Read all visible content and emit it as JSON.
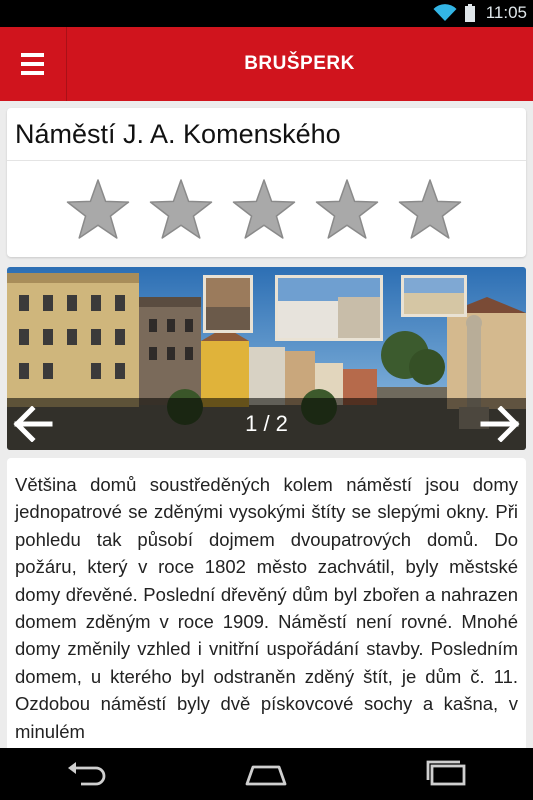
{
  "status_bar": {
    "time": "11:05",
    "wifi_icon": "wifi-icon",
    "battery_icon": "battery-icon"
  },
  "app_bar": {
    "title": "BRUŠPERK",
    "menu_icon": "hamburger-menu-icon",
    "color": "#d0141d"
  },
  "place": {
    "title": "Náměstí J. A. Komenského",
    "rating": {
      "max": 5,
      "value": 0,
      "icon": "star-icon"
    }
  },
  "gallery": {
    "counter": "1 / 2",
    "current": 1,
    "total": 2,
    "prev_icon": "arrow-left-icon",
    "next_icon": "arrow-right-icon"
  },
  "description": "Většina domů soustředěných kolem náměstí jsou domy jednopatrové se zděnými vysokými štíty se slepými okny. Při pohledu tak působí dojmem dvoupatrových domů. Do požáru, který v roce 1802 město zachvátil, byly městské domy dřevěné. Poslední dřevěný dům byl zbořen a nahrazen domem zděným v roce 1909. Náměstí není rovné. Mnohé domy změnily vzhled i vnitřní uspořádání stavby. Posledním domem, u kterého byl odstraněn zděný štít, je dům č. 11. Ozdobou náměstí byly dvě pískovcové sochy a kašna, v minulém",
  "nav_bar": {
    "back_icon": "back-icon",
    "home_icon": "home-icon",
    "recents_icon": "recents-icon"
  }
}
